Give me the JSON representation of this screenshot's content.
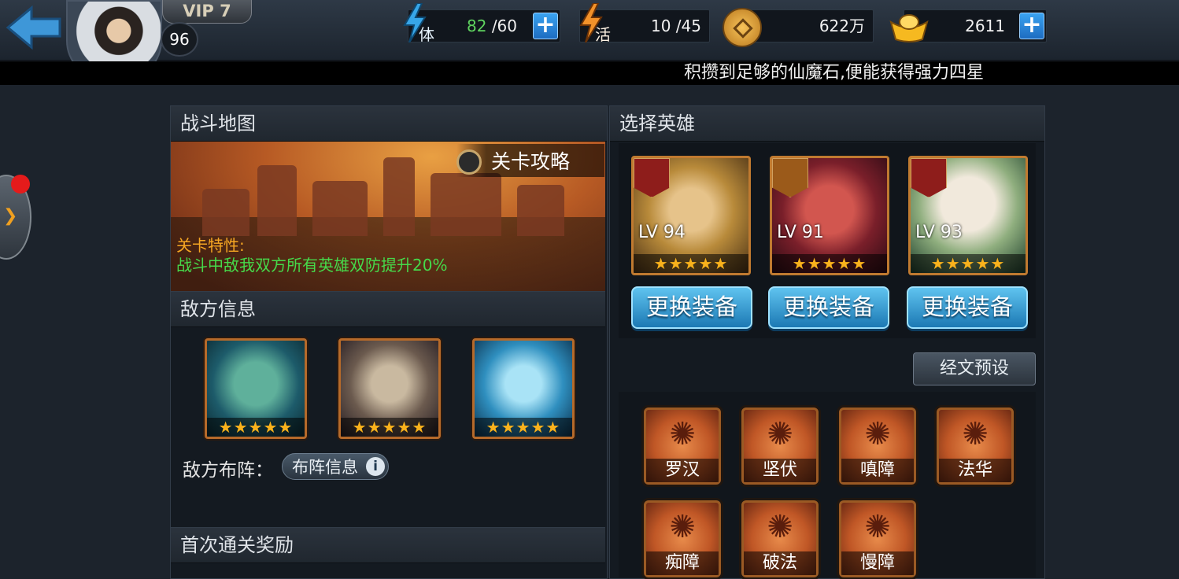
{
  "header": {
    "vip": "VIP 7",
    "level": "96",
    "stamina": {
      "label": "体",
      "current": "82",
      "max": "/60"
    },
    "energy": {
      "label": "活",
      "value": "10 /45"
    },
    "coins": "622万",
    "gold": "2611",
    "plus": "+",
    "marquee": "积攒到足够的仙魔石,便能获得强力四星"
  },
  "battle_map": {
    "title": "战斗地图",
    "guide": "关卡攻略",
    "feature_title": "关卡特性:",
    "feature_text": "战斗中敌我双方所有英雄双防提升20%"
  },
  "enemy": {
    "title": "敌方信息",
    "portraits": [
      {
        "stars": "★★★★★"
      },
      {
        "stars": "★★★★★"
      },
      {
        "stars": "★★★★★"
      }
    ],
    "formation_label": "敌方布阵：",
    "formation_button": "布阵信息",
    "info_glyph": "i"
  },
  "first_clear": {
    "title": "首次通关奖励"
  },
  "heroes": {
    "title": "选择英雄",
    "list": [
      {
        "level": "LV 94",
        "stars": "★★★★★",
        "equip": "更换装备"
      },
      {
        "level": "LV 91",
        "stars": "★★★★★",
        "equip": "更换装备"
      },
      {
        "level": "LV 93",
        "stars": "★★★★★",
        "equip": "更换装备"
      }
    ]
  },
  "runes": {
    "preset_button": "经文预设",
    "items": [
      {
        "name": "罗汉"
      },
      {
        "name": "坚伏"
      },
      {
        "name": "嗔障"
      },
      {
        "name": "法华"
      },
      {
        "name": "痴障"
      },
      {
        "name": "破法"
      },
      {
        "name": "慢障"
      }
    ]
  },
  "colors": {
    "accent_blue": "#1d79c1",
    "feature_orange": "#f5a623",
    "feature_green": "#46d94a",
    "notify_red": "#e51b1b"
  }
}
